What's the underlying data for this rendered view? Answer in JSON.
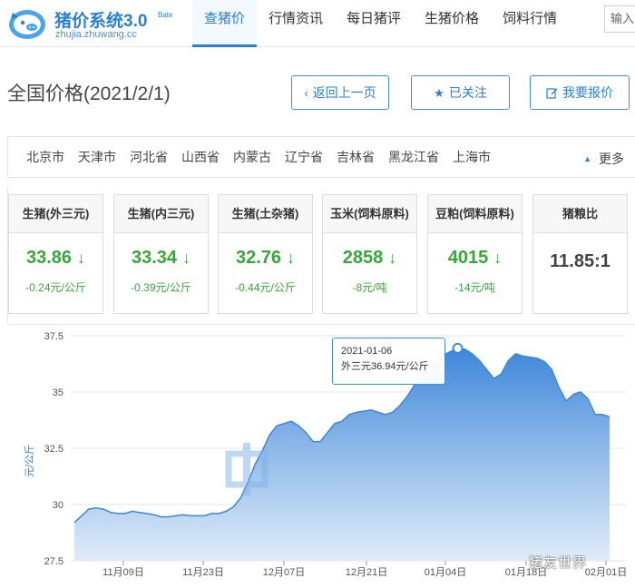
{
  "header": {
    "logo_title": "猪价系统3.0",
    "logo_beta": "Bate",
    "logo_url": "zhujia.zhuwang.cc",
    "nav": [
      "查猪价",
      "行情资讯",
      "每日猪评",
      "生猪价格",
      "饲料行情"
    ],
    "search_placeholder": "输入"
  },
  "page": {
    "title": "全国价格(2021/2/1)",
    "back_label": "返回上一页",
    "follow_label": "已关注",
    "report_label": "我要报价"
  },
  "regions": {
    "items": [
      "北京市",
      "天津市",
      "河北省",
      "山西省",
      "内蒙古",
      "辽宁省",
      "吉林省",
      "黑龙江省",
      "上海市"
    ],
    "more_label": "更多"
  },
  "cards": [
    {
      "name": "生猪(外三元)",
      "value": "33.86",
      "change": "-0.24元/公斤",
      "trend": "down"
    },
    {
      "name": "生猪(内三元)",
      "value": "33.34",
      "change": "-0.39元/公斤",
      "trend": "down"
    },
    {
      "name": "生猪(土杂猪)",
      "value": "32.76",
      "change": "-0.44元/公斤",
      "trend": "down"
    },
    {
      "name": "玉米(饲料原料)",
      "value": "2858",
      "change": "-8元/吨",
      "trend": "down"
    },
    {
      "name": "豆粕(饲料原料)",
      "value": "4015",
      "change": "-14元/吨",
      "trend": "down"
    },
    {
      "name": "猪粮比",
      "value": "11.85:1",
      "change": "",
      "trend": "none"
    }
  ],
  "colors": {
    "accent": "#2a7fd6",
    "down": "#3aa53a",
    "chart_line": "#3d86d9"
  },
  "chart_data": {
    "type": "area",
    "ylabel": "元/公斤",
    "ylim": [
      27.5,
      37.5
    ],
    "yticks": [
      27.5,
      30,
      32.5,
      35,
      37.5
    ],
    "xticks": [
      "11月09日",
      "11月23日",
      "12月07日",
      "12月21日",
      "01月04日",
      "01月18日",
      "02月01日"
    ],
    "x": [
      0,
      1,
      2,
      3,
      4,
      5,
      6,
      7,
      8,
      9,
      10,
      11,
      12,
      13,
      14,
      15,
      16,
      17,
      18,
      19,
      20,
      21,
      22,
      23,
      24,
      25,
      26,
      27,
      28,
      29,
      30,
      31,
      32,
      33,
      34,
      35,
      36,
      37,
      38,
      39,
      40,
      41,
      42,
      43,
      44,
      45,
      46,
      47,
      48,
      49,
      50,
      51,
      52,
      53,
      54,
      55,
      56,
      57,
      58,
      59,
      60,
      61,
      62,
      63,
      64,
      65,
      66,
      67,
      68,
      69,
      70,
      71,
      72,
      73,
      74,
      75,
      76,
      77,
      78,
      79,
      80,
      81,
      82,
      83,
      84,
      85,
      86,
      87,
      88,
      89,
      90,
      91,
      92
    ],
    "series": [
      {
        "name": "外三元",
        "values": [
          29.2,
          29.5,
          29.8,
          29.85,
          29.8,
          29.65,
          29.6,
          29.6,
          29.7,
          29.65,
          29.6,
          29.55,
          29.45,
          29.45,
          29.5,
          29.55,
          29.5,
          29.5,
          29.5,
          29.6,
          29.6,
          29.7,
          29.9,
          30.3,
          31.0,
          31.8,
          32.4,
          33.1,
          33.5,
          33.6,
          33.7,
          33.5,
          33.2,
          32.8,
          32.8,
          33.2,
          33.6,
          33.7,
          34.0,
          34.1,
          34.15,
          34.2,
          34.1,
          34.0,
          34.1,
          34.4,
          34.8,
          35.3,
          35.8,
          36.1,
          36.4,
          36.65,
          36.8,
          36.94,
          36.9,
          36.7,
          36.4,
          36.0,
          35.6,
          35.8,
          36.4,
          36.7,
          36.6,
          36.55,
          36.5,
          36.35,
          36.0,
          35.2,
          34.6,
          34.9,
          35.0,
          34.7,
          34.0,
          34.0,
          33.9
        ],
        "x_index_step": 1.25
      }
    ],
    "tooltip": {
      "date": "2021-01-06",
      "label": "外三元36.94元/公斤"
    },
    "grid": true,
    "legend": "none"
  },
  "watermark": "猪友世界"
}
